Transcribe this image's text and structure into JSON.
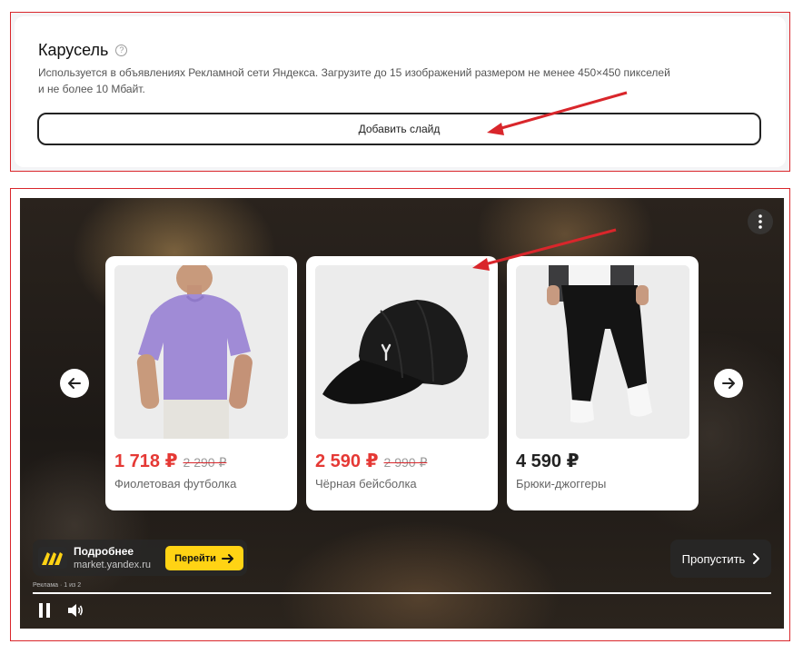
{
  "carousel_panel": {
    "title": "Карусель",
    "description_line1": "Используется в объявлениях Рекламной сети Яндекса. Загрузите до 15 изображений размером не менее 450×450 пикселей",
    "description_line2": "и не более 10 Мбайт.",
    "add_slide_label": "Добавить слайд"
  },
  "preview": {
    "cards": [
      {
        "price": "1 718 ₽",
        "old_price": "2 290 ₽",
        "name": "Фиолетовая футболка",
        "price_color": "#e53935"
      },
      {
        "price": "2 590 ₽",
        "old_price": "2 990 ₽",
        "name": "Чёрная бейсболка",
        "price_color": "#e53935"
      },
      {
        "price": "4 590 ₽",
        "old_price": "",
        "name": "Брюки-джоггеры",
        "price_color": "#222222"
      }
    ],
    "brand": {
      "title": "Подробнее",
      "url": "market.yandex.ru",
      "go_label": "Перейти"
    },
    "skip_label": "Пропустить",
    "ad_label": "Реклама · 1 из 2",
    "progress": 1.0
  },
  "colors": {
    "accent_red": "#d9262b",
    "brand_yellow": "#ffd314"
  },
  "icons": [
    "help-icon",
    "more-vertical-icon",
    "arrow-left-icon",
    "arrow-right-icon",
    "market-logo-icon",
    "chevron-right-icon",
    "pause-icon",
    "volume-icon"
  ]
}
